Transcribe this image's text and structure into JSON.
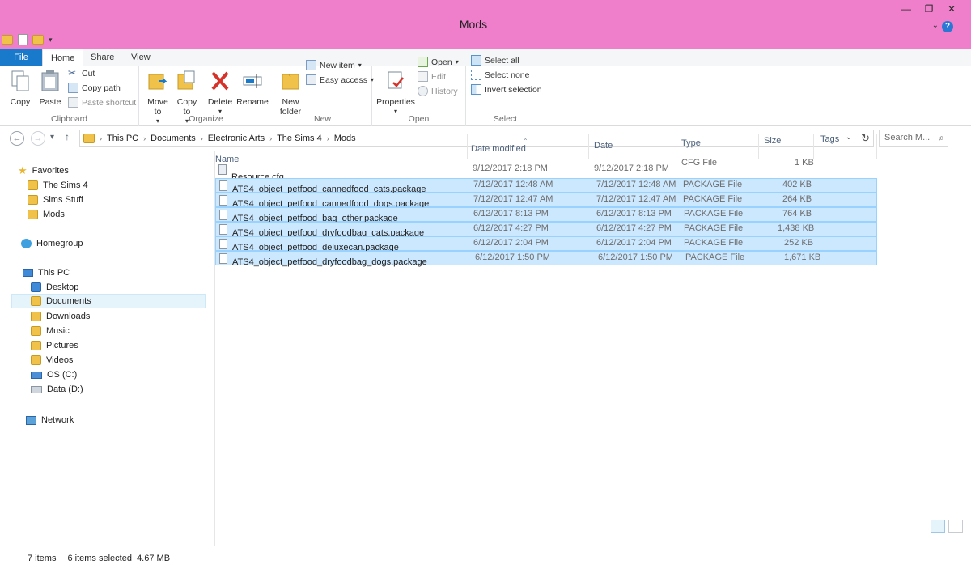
{
  "window": {
    "title": "Mods",
    "controls": [
      "—",
      "❐",
      "✕"
    ],
    "help_label": "?"
  },
  "tabs": [
    "File",
    "Home",
    "Share",
    "View"
  ],
  "ribbon": {
    "clipboard": {
      "label": "Clipboard",
      "copy": "Copy",
      "paste": "Paste",
      "cut": "Cut",
      "copy_path": "Copy path",
      "paste_shortcut": "Paste shortcut"
    },
    "organize": {
      "label": "Organize",
      "move_to": "Move to",
      "copy_to": "Copy to",
      "delete": "Delete",
      "rename": "Rename"
    },
    "new": {
      "label": "New",
      "new_folder": "New folder",
      "new_item": "New item",
      "easy_access": "Easy access"
    },
    "open": {
      "label": "Open",
      "properties": "Properties",
      "open": "Open",
      "edit": "Edit",
      "history": "History"
    },
    "select": {
      "label": "Select",
      "select_all": "Select all",
      "select_none": "Select none",
      "invert_selection": "Invert selection"
    }
  },
  "address": {
    "crumbs": [
      "This PC",
      "Documents",
      "Electronic Arts",
      "The Sims 4",
      "Mods"
    ],
    "search_placeholder": "Search M..."
  },
  "nav": {
    "favorites": "Favorites",
    "fav_items": [
      "The Sims 4",
      "Sims Stuff",
      "Mods"
    ],
    "homegroup": "Homegroup",
    "this_pc": "This PC",
    "pc_items": [
      "Desktop",
      "Documents",
      "Downloads",
      "Music",
      "Pictures",
      "Videos",
      "OS (C:)",
      "Data (D:)"
    ],
    "network": "Network"
  },
  "columns": [
    "Name",
    "Date modified",
    "Date",
    "Type",
    "Size",
    "Tags"
  ],
  "files": [
    {
      "name": "Resource.cfg",
      "modified": "9/12/2017 2:18 PM",
      "date": "9/12/2017 2:18 PM",
      "type": "CFG File",
      "size": "1 KB",
      "selected": false
    },
    {
      "name": "ATS4_object_petfood_cannedfood_cats.package",
      "modified": "7/12/2017 12:48 AM",
      "date": "7/12/2017 12:48 AM",
      "type": "PACKAGE File",
      "size": "402 KB",
      "selected": true
    },
    {
      "name": "ATS4_object_petfood_cannedfood_dogs.package",
      "modified": "7/12/2017 12:47 AM",
      "date": "7/12/2017 12:47 AM",
      "type": "PACKAGE File",
      "size": "264 KB",
      "selected": true
    },
    {
      "name": "ATS4_object_petfood_bag_other.package",
      "modified": "6/12/2017 8:13 PM",
      "date": "6/12/2017 8:13 PM",
      "type": "PACKAGE File",
      "size": "764 KB",
      "selected": true
    },
    {
      "name": "ATS4_object_petfood_dryfoodbag_cats.package",
      "modified": "6/12/2017 4:27 PM",
      "date": "6/12/2017 4:27 PM",
      "type": "PACKAGE File",
      "size": "1,438 KB",
      "selected": true
    },
    {
      "name": "ATS4_object_petfood_deluxecan.package",
      "modified": "6/12/2017 2:04 PM",
      "date": "6/12/2017 2:04 PM",
      "type": "PACKAGE File",
      "size": "252 KB",
      "selected": true
    },
    {
      "name": "ATS4_object_petfood_dryfoodbag_dogs.package",
      "modified": "6/12/2017 1:50 PM",
      "date": "6/12/2017 1:50 PM",
      "type": "PACKAGE File",
      "size": "1,671 KB",
      "selected": true
    }
  ],
  "status": {
    "items": "7 items",
    "selected": "6 items selected  4.67 MB"
  },
  "colors": {
    "titlebar": "#ef7fcb",
    "file_tab": "#1979ca",
    "selection": "#cce8ff"
  }
}
